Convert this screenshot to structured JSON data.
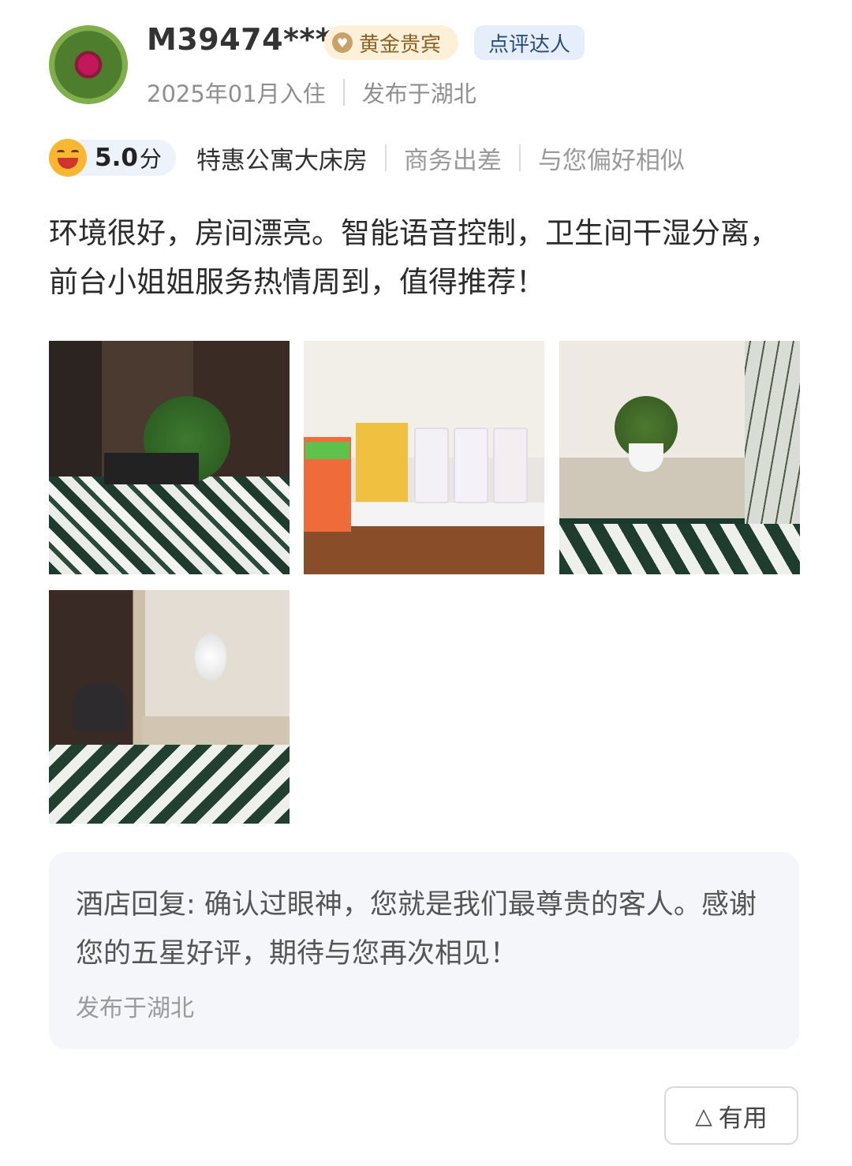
{
  "user": {
    "name": "M39474****",
    "badge_gold": "黄金贵宾",
    "badge_reviewer": "点评达人",
    "stay": "2025年01月入住",
    "location": "发布于湖北"
  },
  "rating": {
    "score": "5.0",
    "unit": "分",
    "room_type": "特惠公寓大床房",
    "trip_type": "商务出差",
    "similarity": "与您偏好相似"
  },
  "review": {
    "text": "环境很好，房间漂亮。智能语音控制，卫生间干湿分离，前台小姐姐服务热情周到，值得推荐！"
  },
  "photos": {
    "count": 4
  },
  "hotel_reply": {
    "text": "酒店回复: 确认过眼神，您就是我们最尊贵的客人。感谢您的五星好评，期待与您再次相见！",
    "location": "发布于湖北"
  },
  "actions": {
    "useful_label": "有用",
    "useful_icon": "triangle-up-icon"
  },
  "colors": {
    "gold_badge_bg": "#fdf0d9",
    "gold_badge_text": "#8a6325",
    "blue_badge_bg": "#e6eefb",
    "blue_badge_text": "#2b4d7e",
    "reply_bg": "#f4f6f9"
  }
}
